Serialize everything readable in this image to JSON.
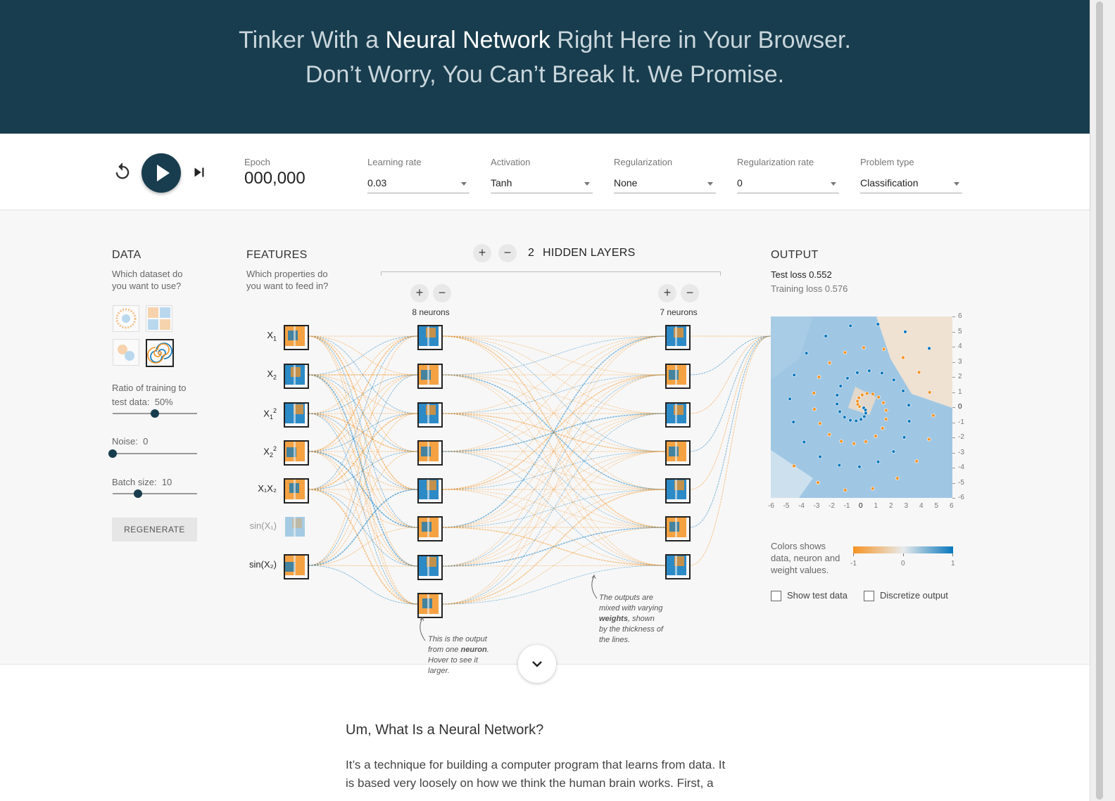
{
  "header": {
    "line1_pre": "Tinker With a ",
    "line1_bold": "Neural Network",
    "line1_post": " Right Here in Your Browser.",
    "line2": "Don’t Worry, You Can’t Break It. We Promise."
  },
  "controls": {
    "epoch_label": "Epoch",
    "epoch_value": "000,000",
    "learning_rate": {
      "label": "Learning rate",
      "value": "0.03"
    },
    "activation": {
      "label": "Activation",
      "value": "Tanh"
    },
    "regularization": {
      "label": "Regularization",
      "value": "None"
    },
    "regularization_rate": {
      "label": "Regularization rate",
      "value": "0"
    },
    "problem_type": {
      "label": "Problem type",
      "value": "Classification"
    }
  },
  "data_panel": {
    "title": "DATA",
    "subtitle": "Which dataset do you want to use?",
    "ratio_label": "Ratio of training to test data:",
    "ratio_value": "50%",
    "ratio_fraction": 0.5,
    "noise_label": "Noise:",
    "noise_value": "0",
    "noise_fraction": 0.0,
    "batch_label": "Batch size:",
    "batch_value": "10",
    "batch_fraction": 0.3,
    "regenerate": "REGENERATE",
    "selected_dataset": "spiral"
  },
  "features": {
    "title": "FEATURES",
    "subtitle": "Which properties do you want to feed in?",
    "items": [
      {
        "base": "X",
        "sub": "1",
        "sup": "",
        "active": true
      },
      {
        "base": "X",
        "sub": "2",
        "sup": "",
        "active": true
      },
      {
        "base": "X",
        "sub": "1",
        "sup": "2",
        "active": true
      },
      {
        "base": "X",
        "sub": "2",
        "sup": "2",
        "active": true
      },
      {
        "base": "X₁X₂",
        "sub": "",
        "sup": "",
        "active": true
      },
      {
        "base": "sin(X₁)",
        "sub": "",
        "sup": "",
        "active": false
      },
      {
        "base": "sin(X₂)",
        "sub": "",
        "sup": "",
        "active": true
      }
    ]
  },
  "network": {
    "hidden_layers_count": "2",
    "hidden_layers_label": "HIDDEN LAYERS",
    "layer1_neurons": "8 neurons",
    "layer2_neurons": "7 neurons",
    "callout_neuron": [
      "This is the output",
      "from one neuron.",
      "Hover to see it",
      "larger."
    ],
    "callout_weights": [
      "The outputs are",
      "mixed with varying",
      "weights, shown",
      "by the thickness of",
      "the lines."
    ]
  },
  "output": {
    "title": "OUTPUT",
    "test_loss_label": "Test loss",
    "test_loss_value": "0.552",
    "training_loss_label": "Training loss",
    "training_loss_value": "0.576",
    "x_ticks": [
      "-6",
      "-5",
      "-4",
      "-3",
      "-2",
      "-1",
      "0",
      "1",
      "2",
      "3",
      "4",
      "5",
      "6"
    ],
    "y_ticks": [
      "6",
      "5",
      "4",
      "3",
      "2",
      "1",
      "0",
      "-1",
      "-2",
      "-3",
      "-4",
      "-5",
      "-6"
    ],
    "legend_text": [
      "Colors shows",
      "data, neuron and",
      "weight values."
    ],
    "legend_min": "-1",
    "legend_mid": "0",
    "legend_max": "1",
    "show_test_data": "Show test data",
    "discretize_output": "Discretize output"
  },
  "colors": {
    "header_bg": "#183d4e",
    "orange": "#f59322",
    "blue": "#0877bd"
  },
  "article": {
    "title": "Um, What Is a Neural Network?",
    "body": "It’s a technique for building a computer program that learns from data. It is based very loosely on how we think the human brain works. First, a"
  }
}
